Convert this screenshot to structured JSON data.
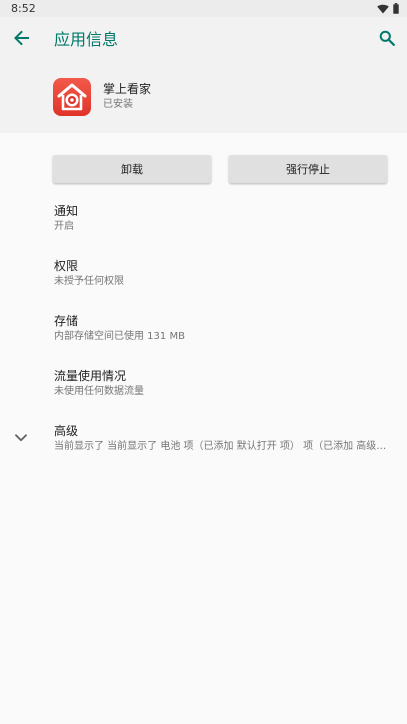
{
  "status_bar": {
    "time": "8:52",
    "icons": [
      "wifi-icon",
      "battery-icon"
    ]
  },
  "app_bar": {
    "title": "应用信息",
    "back_icon": "arrow-back-icon",
    "search_icon": "search-icon",
    "accent_color": "#00796b"
  },
  "app_header": {
    "name": "掌上看家",
    "status": "已安装",
    "icon": "home-camera-app-icon"
  },
  "buttons": {
    "uninstall": "卸载",
    "force_stop": "强行停止"
  },
  "preferences": [
    {
      "title": "通知",
      "summary": "开启"
    },
    {
      "title": "权限",
      "summary": "未授予任何权限"
    },
    {
      "title": "存储",
      "summary": "内部存储空间已使用 131 MB"
    },
    {
      "title": "流量使用情况",
      "summary": "未使用任何数据流量"
    }
  ],
  "advanced": {
    "title": "高级",
    "summary": "当前显示了 当前显示了 电池 项（已添加 默认打开 项） 项（已添加 高级…",
    "icon": "chevron-down-icon"
  }
}
